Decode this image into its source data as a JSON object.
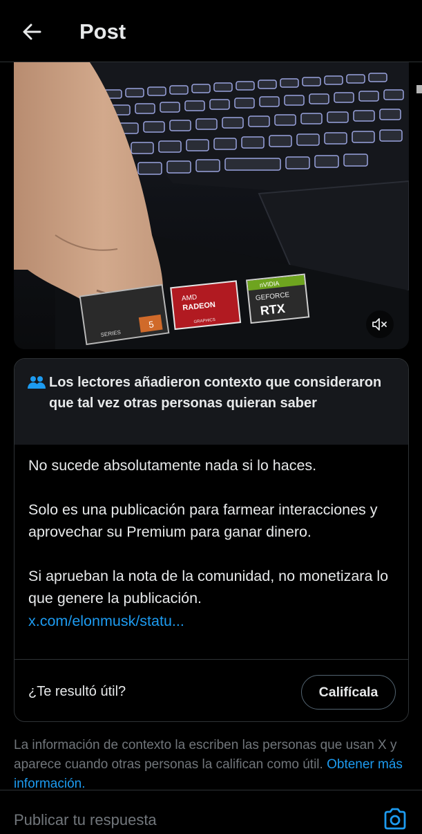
{
  "header": {
    "title": "Post",
    "back_icon": "arrow-left-icon"
  },
  "media": {
    "description_icons": [
      "mute-icon"
    ],
    "stickers": {
      "amd_line1": "AMD",
      "amd_line2": "RADEON",
      "amd_line3": "GRAPHICS",
      "nvidia_brand": "nVIDIA",
      "nvidia_line1": "GEFORCE",
      "nvidia_line2": "RTX",
      "ryzen_series": "SERIES",
      "ryzen_number": "5"
    }
  },
  "community_note": {
    "header_text": "Los lectores añadieron contexto que consideraron que tal vez otras personas quieran saber",
    "paragraph1": "No sucede absolutamente nada si lo haces.",
    "paragraph2": "Solo es una publicación para farmear interacciones y aprovechar su Premium para ganar dinero.",
    "paragraph3": "Si aprueban la nota de la comunidad, no monetizara lo que genere la publicación.",
    "link": "x.com/elonmusk/statu...",
    "helpful_question": "¿Te resultó útil?",
    "rate_button": "Califícala"
  },
  "disclaimer": {
    "text": "La información de contexto la escriben las personas que usan X y aparece cuando otras personas la califican como útil.",
    "more_link": "Obtener más información."
  },
  "reply_bar": {
    "placeholder": "Publicar tu respuesta",
    "camera_icon": "camera-icon"
  },
  "colors": {
    "background": "#000000",
    "text": "#e7e9ea",
    "muted": "#71767b",
    "accent": "#1d9bf0",
    "border": "#2f3336",
    "note_header_bg": "#16181c"
  }
}
